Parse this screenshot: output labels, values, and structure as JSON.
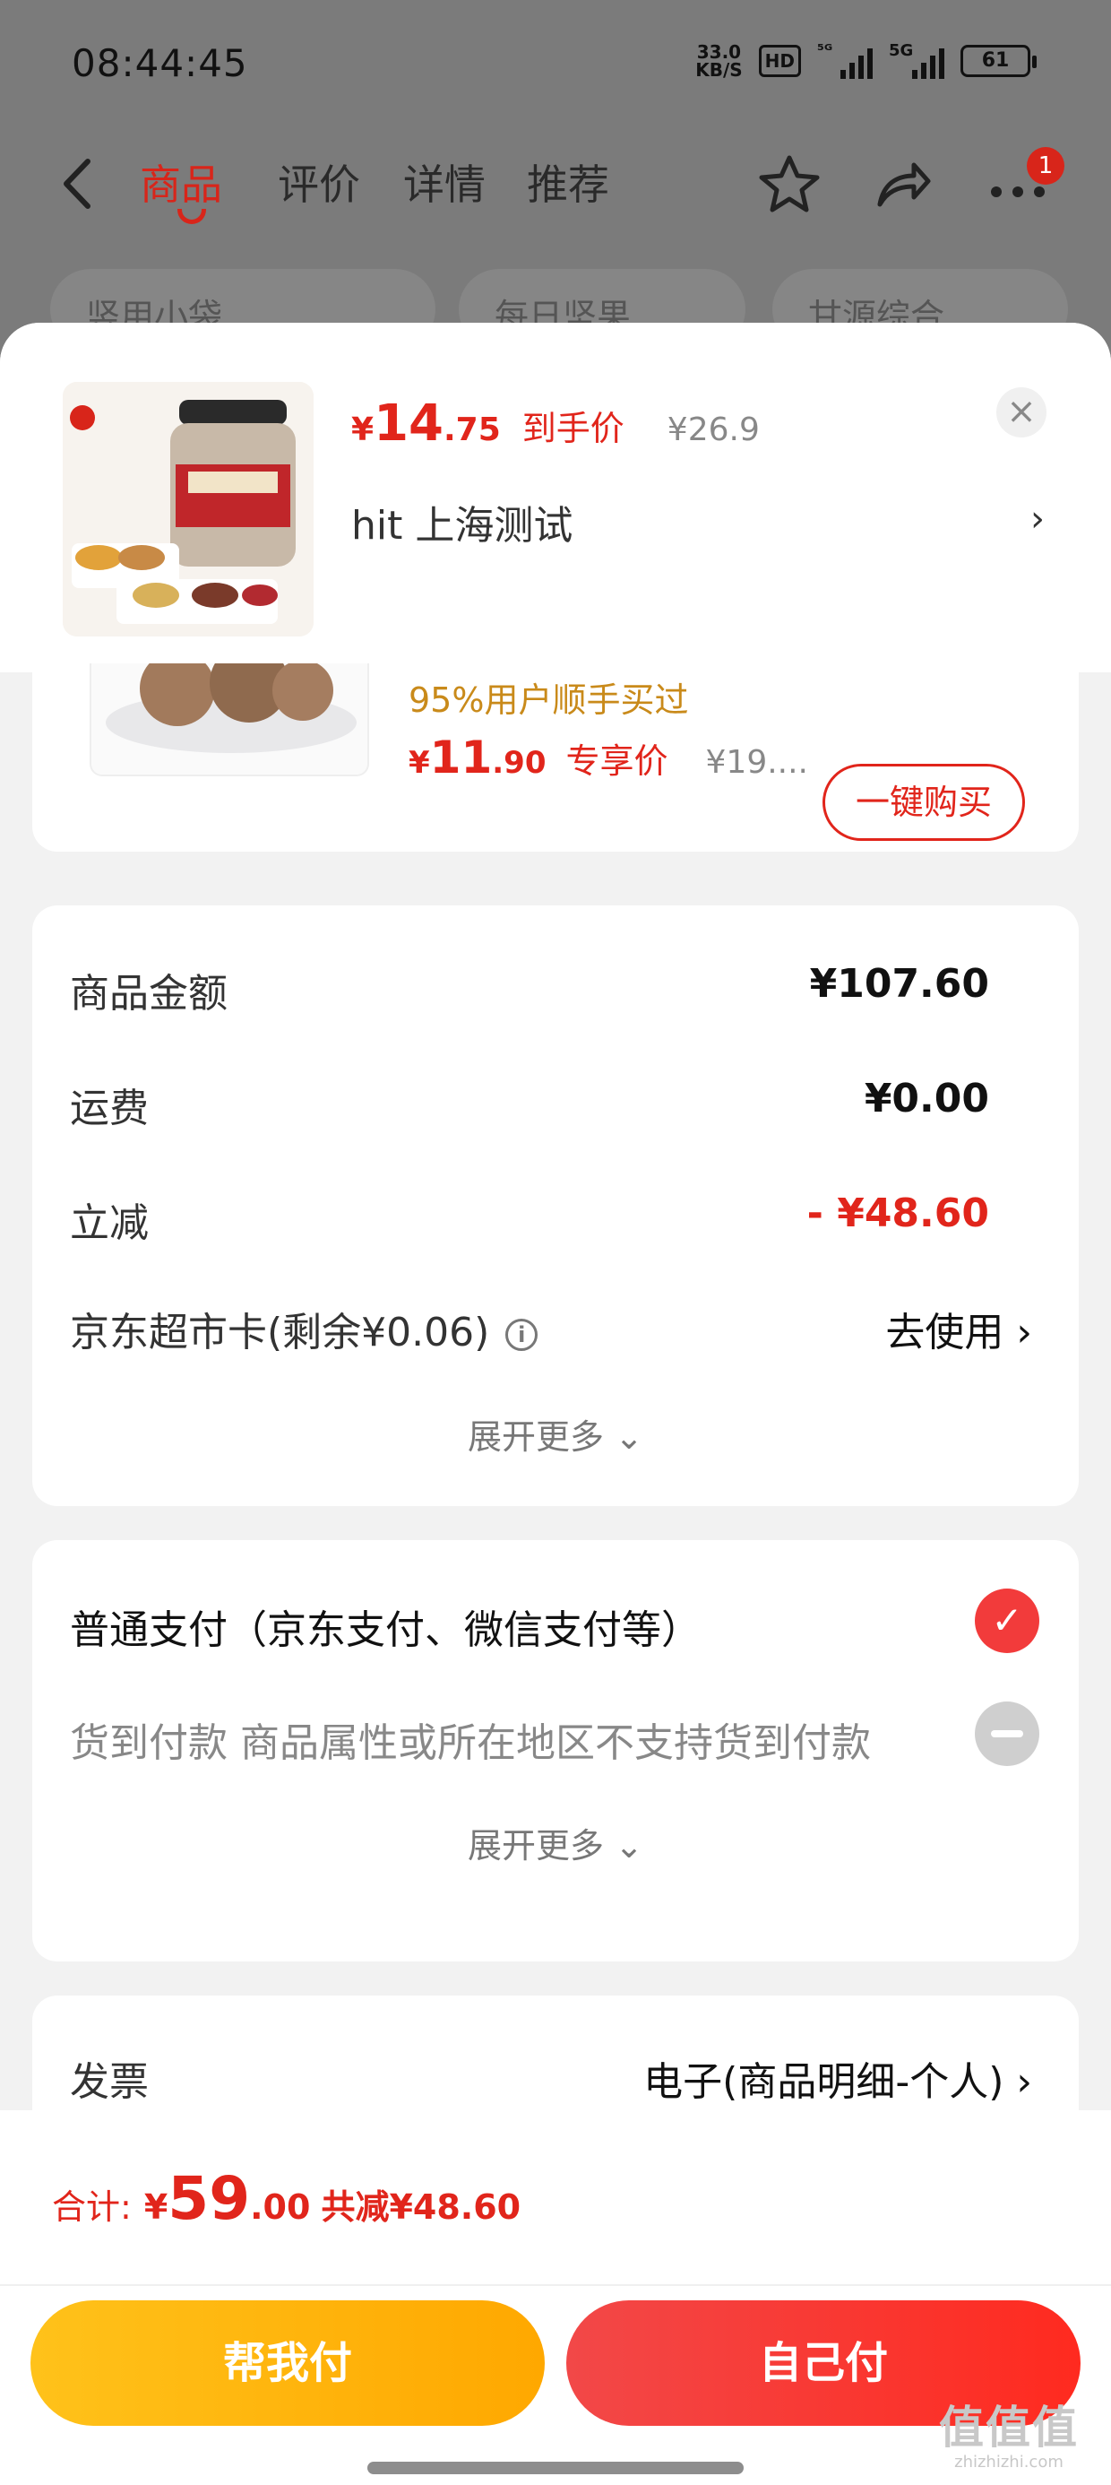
{
  "status_bar": {
    "time": "08:44:45",
    "net_speed_value": "33.0",
    "net_speed_unit": "KB/S",
    "hd": "HD",
    "signal1_tag": "⁵ᴳ",
    "signal2_tag": "5G",
    "battery": "61"
  },
  "topnav": {
    "tabs": [
      "商品",
      "评价",
      "详情",
      "推荐"
    ],
    "active_tab": "商品",
    "more_badge": "1"
  },
  "chips": [
    "竖用小袋",
    "每日坚果",
    "甘源综合"
  ],
  "sheet": {
    "product": {
      "price_currency": "¥",
      "price_int": "14",
      "price_dec": ".75",
      "price_label": "到手价",
      "original_price": "¥26.9",
      "address": "hit  上海测试"
    },
    "recommend": {
      "tip": "95%用户顺手买过",
      "price_currency": "¥",
      "price_int": "11",
      "price_dec": ".90",
      "price_label": "专享价",
      "original_price": "¥19....",
      "buy_button": "一键购买"
    },
    "summary": {
      "goods_amount_label": "商品金额",
      "goods_amount": "¥107.60",
      "shipping_label": "运费",
      "shipping": "¥0.00",
      "discount_label": "立减",
      "discount": "- ¥48.60",
      "card_label": "京东超市卡(剩余¥0.06)",
      "card_action": "去使用",
      "expand": "展开更多"
    },
    "payment": {
      "normal": "普通支付（京东支付、微信支付等）",
      "cod": "货到付款 商品属性或所在地区不支持货到付款",
      "expand": "展开更多"
    },
    "invoice": {
      "label": "发票",
      "value": "电子(商品明细-个人)"
    }
  },
  "footer": {
    "total_label": "合计:",
    "total_currency": "¥",
    "total_int": "59",
    "total_dec": ".00",
    "total_discount": "共减¥48.60",
    "help_pay": "帮我付",
    "self_pay": "自己付"
  },
  "watermark": {
    "big": "值值值",
    "small": "zhizhizhi.com"
  },
  "colors": {
    "accent_red": "#e1251b",
    "gold_button": "#ffb400",
    "tip_orange": "#c98a1a"
  }
}
